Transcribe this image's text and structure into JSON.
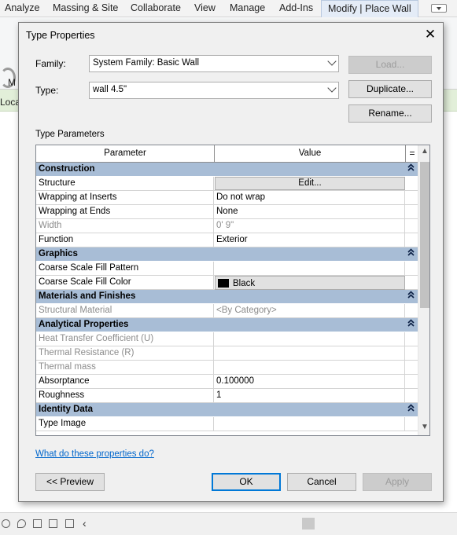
{
  "ribbon": {
    "tabs": [
      "Analyze",
      "Massing & Site",
      "Collaborate",
      "View",
      "Manage",
      "Add-Ins"
    ],
    "active_tab": "Modify | Place Wall",
    "bg_label_mo": "M",
    "bg_label_loc": "Loca"
  },
  "dialog": {
    "title": "Type Properties",
    "family_label": "Family:",
    "family_value": "System Family: Basic Wall",
    "type_label": "Type:",
    "type_value": "wall 4.5\"",
    "load_button": "Load...",
    "duplicate_button": "Duplicate...",
    "rename_button": "Rename...",
    "type_parameters_title": "Type Parameters",
    "columns": {
      "parameter": "Parameter",
      "value": "Value",
      "eq": "="
    },
    "groups": [
      {
        "name": "Construction",
        "rows": [
          {
            "param": "Structure",
            "value": "Edit...",
            "kind": "button"
          },
          {
            "param": "Wrapping at Inserts",
            "value": "Do not wrap"
          },
          {
            "param": "Wrapping at Ends",
            "value": "None"
          },
          {
            "param": "Width",
            "value": "0'  9\"",
            "dim": true
          },
          {
            "param": "Function",
            "value": "Exterior"
          }
        ]
      },
      {
        "name": "Graphics",
        "rows": [
          {
            "param": "Coarse Scale Fill Pattern",
            "value": ""
          },
          {
            "param": "Coarse Scale Fill Color",
            "value": "Black",
            "kind": "color",
            "color": "#000000"
          }
        ]
      },
      {
        "name": "Materials and Finishes",
        "rows": [
          {
            "param": "Structural Material",
            "value": "<By Category>",
            "dim": true
          }
        ]
      },
      {
        "name": "Analytical Properties",
        "rows": [
          {
            "param": "Heat Transfer Coefficient (U)",
            "value": "",
            "dim": true
          },
          {
            "param": "Thermal Resistance (R)",
            "value": "",
            "dim": true
          },
          {
            "param": "Thermal mass",
            "value": "",
            "dim": true
          },
          {
            "param": "Absorptance",
            "value": "0.100000"
          },
          {
            "param": "Roughness",
            "value": "1"
          }
        ]
      },
      {
        "name": "Identity Data",
        "rows": [
          {
            "param": "Type Image",
            "value": ""
          }
        ]
      }
    ],
    "help_link": "What do these properties do?",
    "preview_button": "<< Preview",
    "ok_button": "OK",
    "cancel_button": "Cancel",
    "apply_button": "Apply"
  },
  "colors": {
    "group_header": "#a8bdd6",
    "link": "#0066cc",
    "default_button_border": "#0078d7",
    "ribbon_green": "#e2efd9"
  }
}
